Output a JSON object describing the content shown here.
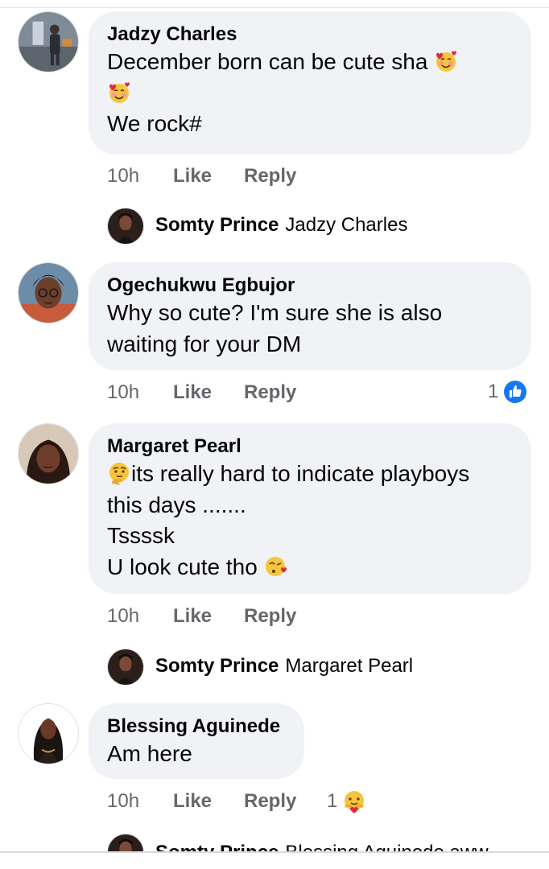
{
  "comments": [
    {
      "author": "Jadzy Charles",
      "lines": [
        "December born can be cute sha",
        "",
        "We rock#"
      ],
      "time": "10h",
      "like": "Like",
      "reply": "Reply",
      "reply_preview": {
        "name": "Somty Prince",
        "text": "Jadzy Charles"
      }
    },
    {
      "author": "Ogechukwu Egbujor",
      "lines": [
        "Why so cute? I'm sure she is also",
        "waiting for your DM"
      ],
      "time": "10h",
      "like": "Like",
      "reply": "Reply",
      "reaction_count": "1",
      "reaction_icon": "like-thumb-icon"
    },
    {
      "author": "Margaret Pearl",
      "lines": [
        "its really hard to indicate playboys",
        "this days .......",
        "Tssssk",
        "U look cute tho"
      ],
      "time": "10h",
      "like": "Like",
      "reply": "Reply",
      "reply_preview": {
        "name": "Somty Prince",
        "text": "Margaret Pearl"
      }
    },
    {
      "author": "Blessing Aguinede",
      "lines": [
        "Am here"
      ],
      "time": "10h",
      "like": "Like",
      "reply": "Reply",
      "reaction_count": "1",
      "reaction_icon": "care-reaction-icon",
      "reply_preview": {
        "name": "Somty Prince",
        "text": "Blessing Aguinede aww"
      }
    }
  ],
  "colors": {
    "bubble": "#f0f2f5",
    "meta": "#65676b",
    "like_blue": "#1877f2"
  }
}
